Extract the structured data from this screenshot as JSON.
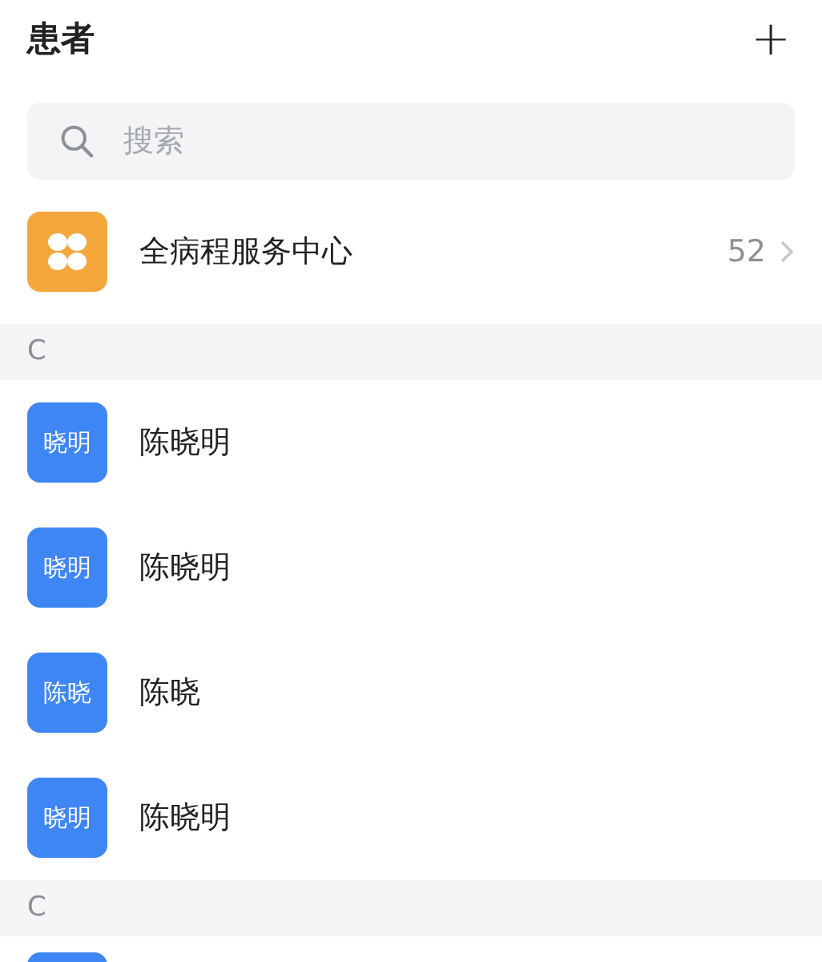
{
  "header": {
    "title": "患者",
    "add_icon": "+"
  },
  "search": {
    "placeholder": "搜索"
  },
  "service": {
    "label": "全病程服务中心",
    "count": "52"
  },
  "sections": [
    {
      "letter": "C",
      "contacts": [
        {
          "kind": "full",
          "avatar": "晓明",
          "name": "陈晓明"
        },
        {
          "kind": "full",
          "avatar": "晓明",
          "name": "陈晓明"
        },
        {
          "kind": "full",
          "avatar": "陈晓",
          "name": "陈晓"
        },
        {
          "kind": "full",
          "avatar": "晓明",
          "name": "陈晓明"
        }
      ]
    },
    {
      "letter": "C",
      "contacts": [
        {
          "kind": "partial"
        }
      ]
    }
  ]
}
